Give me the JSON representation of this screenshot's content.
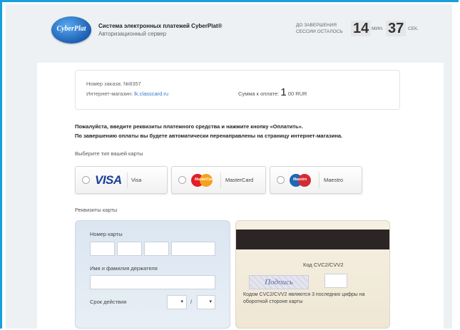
{
  "header": {
    "logo_text": "CyberPlat",
    "system_title": "Система электронных платежей CyberPlat®",
    "system_subtitle": "Авторизационный сервер"
  },
  "session_timer": {
    "label_line1": "До завершения",
    "label_line2": "сессии осталось",
    "minutes": "14",
    "minutes_unit": "мин.",
    "seconds": "37",
    "seconds_unit": "сек."
  },
  "order": {
    "number_label": "Номер заказа:",
    "number": "№8357",
    "shop_label": "Интернет-магазин:",
    "shop_link": "lk.classcard.ru",
    "sum_label": "Сумма к оплате:",
    "sum_main": "1",
    "sum_rest": "00 RUR"
  },
  "notice": {
    "line1": "Пожалуйста, введите реквизиты платежного средства и нажмите кнопку «Оплатить».",
    "line2": "По завершению оплаты вы будете автоматически перенаправлены на страницу интернет-магазина."
  },
  "card_type": {
    "label": "Выберите тип вашей карты",
    "options": [
      {
        "logo": "VISA",
        "name": "Visa"
      },
      {
        "logo": "MasterCard",
        "name": "MasterCard"
      },
      {
        "logo": "Maestro",
        "name": "Maestro"
      }
    ]
  },
  "card_details": {
    "label": "Реквизиты карты",
    "card_number_label": "Номер карты",
    "holder_label": "Имя и фамилия держателя",
    "expiry_label": "Срок действия",
    "expiry_separator": "/",
    "month_value": "",
    "year_value": "",
    "cvc_label": "Код CVC2/CVV2",
    "signature_text": "Подпись",
    "cvc_hint": "Кодом CVC2/CVV2 являются 3 последних цифры на оборотной стороне карты"
  },
  "colors": {
    "frame_border": "#1aa0d9",
    "visa_blue": "#1a3f99",
    "link": "#2f7ac8"
  }
}
